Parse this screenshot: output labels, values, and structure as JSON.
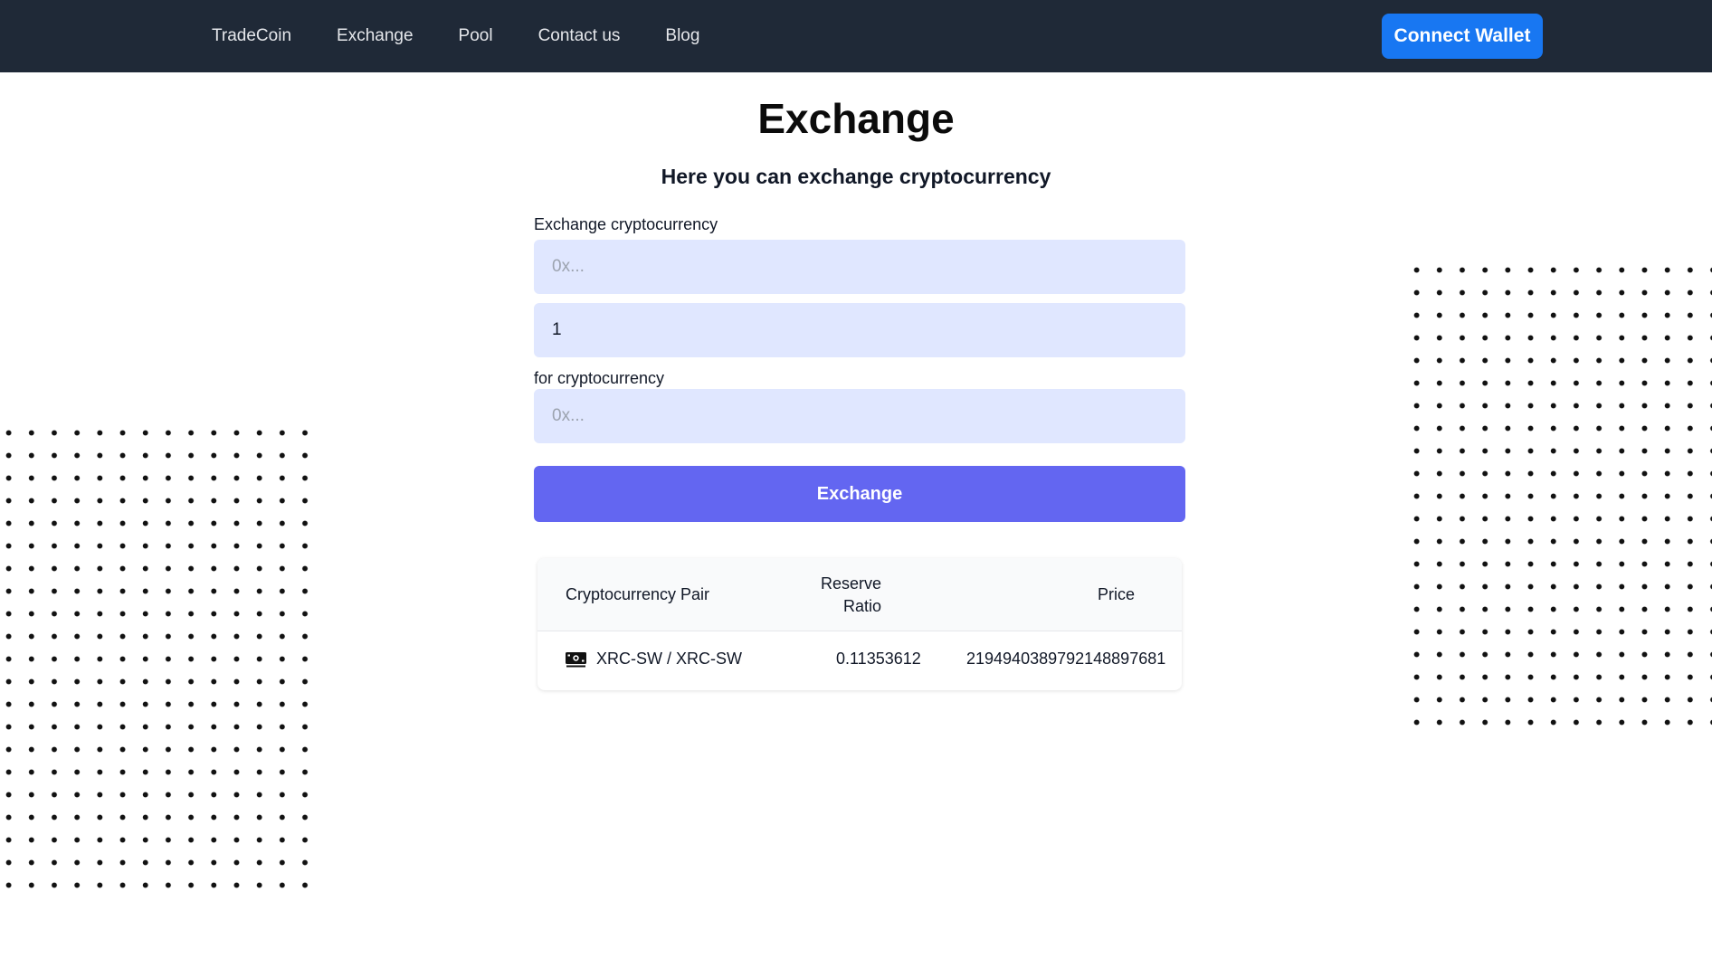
{
  "nav": {
    "links": [
      "TradeCoin",
      "Exchange",
      "Pool",
      "Contact us",
      "Blog"
    ],
    "connect_wallet": "Connect Wallet"
  },
  "main": {
    "title": "Exchange",
    "subtitle": "Here you can exchange cryptocurrency"
  },
  "form": {
    "from_label": "Exchange cryptocurrency",
    "from_placeholder": "0x...",
    "amount_value": "1",
    "to_label": "for cryptocurrency",
    "to_placeholder": "0x...",
    "submit_label": "Exchange"
  },
  "table": {
    "headers": {
      "pair": "Cryptocurrency Pair",
      "reserve_line1": "Reserve",
      "reserve_line2": "Ratio",
      "price": "Price"
    },
    "rows": [
      {
        "icon": "money-icon",
        "pair": "XRC-SW / XRC-SW",
        "reserve_ratio": "0.11353612",
        "price": "2194940389792148897681"
      }
    ]
  },
  "colors": {
    "navbar": "#1f2937",
    "connect_button": "#1877f2",
    "exchange_button": "#6366f1",
    "input_background": "#e0e7ff"
  }
}
